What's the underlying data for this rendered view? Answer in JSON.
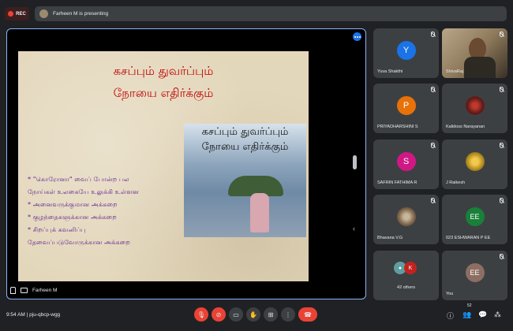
{
  "top": {
    "rec_label": "REC",
    "presenting_text": "Farheen M is presenting"
  },
  "slide": {
    "title_line1": "கசப்பும் துவர்ப்பும்",
    "title_line2": "நோயை எதிர்க்கும்",
    "bullets": [
      "* \"கொரோனா\" வைப் போன்ற பல",
      "நோய்கள் உலகையே உலுக்கி உள்ளன",
      "* அனைவருக்குமான அக்கறை",
      "* குழந்தைகளுக்கான அக்கறை",
      "* சிறப்புக் கவனிப்பு",
      "தேவைப்படுவோருக்கான அக்கறை"
    ],
    "image_caption_line1": "கசப்பும் துவர்ப்பும்",
    "image_caption_line2": "நோயை எதிர்க்கும்"
  },
  "stage": {
    "presenter_name": "Farheen M"
  },
  "tiles": [
    {
      "name": "Yuva Shakthi",
      "initial": "Y",
      "color": "#1a73e8"
    },
    {
      "name": "ShivaRaj",
      "initial": "",
      "color": ""
    },
    {
      "name": "PRIYADHARSHINI S",
      "initial": "P",
      "color": "#e8710a"
    },
    {
      "name": "Kalidoss Narayanan",
      "initial": "",
      "color": ""
    },
    {
      "name": "SAFRIN FATHIMA R",
      "initial": "S",
      "color": "#d01884"
    },
    {
      "name": "J Raikesh",
      "initial": "",
      "color": ""
    },
    {
      "name": "Bhavana V.G",
      "initial": "",
      "color": ""
    },
    {
      "name": "023 ESHWARAN P EE",
      "initial": "EE",
      "color": "#188038"
    },
    {
      "name": "42 others",
      "initial": "K",
      "color": "#c5221f"
    },
    {
      "name": "You",
      "initial": "EE",
      "color": "#8d6e63"
    }
  ],
  "bottom": {
    "time_code": "9:54 AM  |  pju-qbcp-wgg",
    "people_count": "52"
  }
}
